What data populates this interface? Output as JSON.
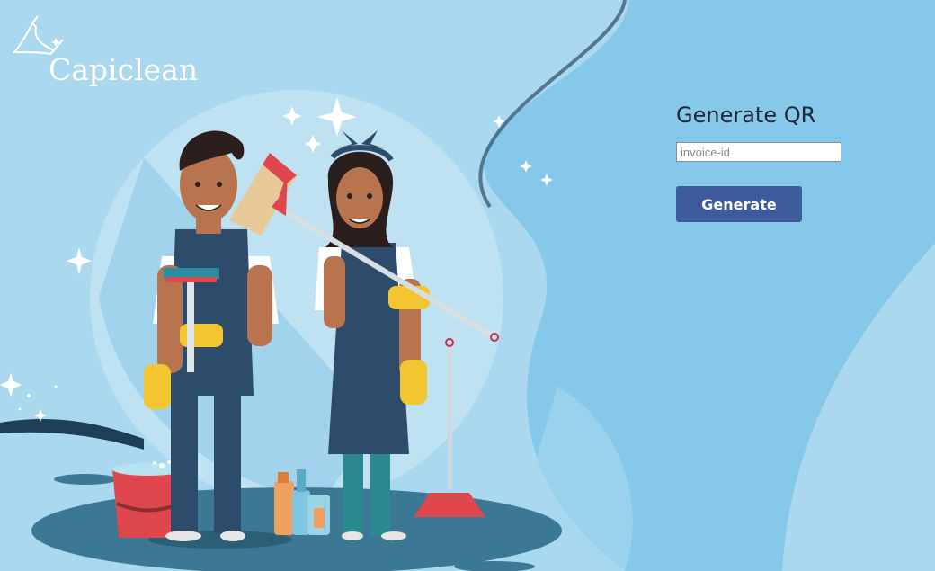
{
  "brand": {
    "name": "Capiclean",
    "logo_icon": "feather-duster-icon"
  },
  "qr_form": {
    "title": "Generate QR",
    "invoice_input": {
      "value": "",
      "placeholder": "invoice-id"
    },
    "generate_label": "Generate"
  },
  "illustration": {
    "subject": "cleaning-staff-illustration",
    "icons": [
      "bucket-icon",
      "broom-icon",
      "squeegee-icon",
      "plunger-icon",
      "spray-bottle-icon",
      "sparkle-icon"
    ]
  },
  "colors": {
    "sky": "#a9d8ef",
    "wave": "#86c8ea",
    "floor": "#3b7894",
    "button": "#3d5b9c",
    "title_text": "#1d2735"
  }
}
